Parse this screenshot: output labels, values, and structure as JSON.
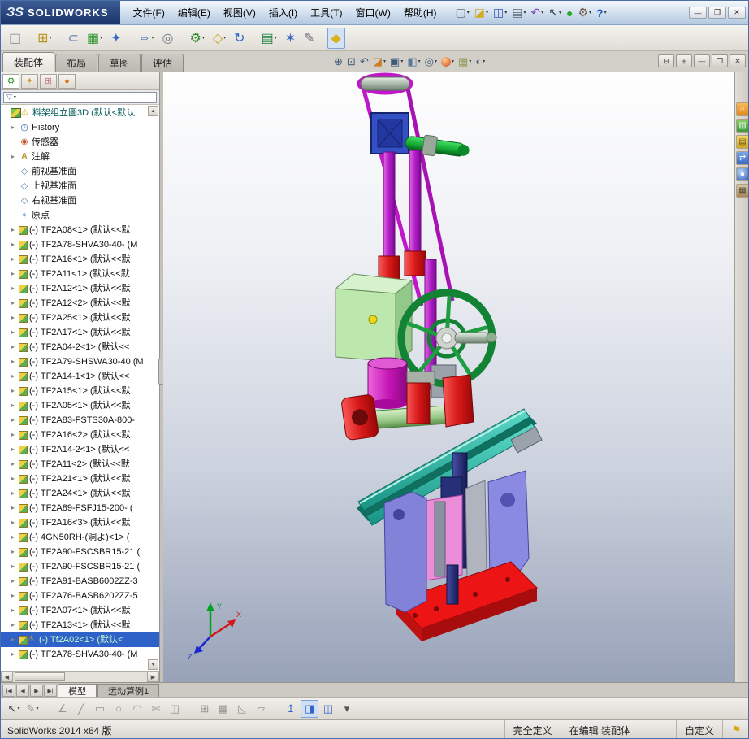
{
  "titlebar": {
    "logo_mark": "ЗS",
    "logo_text": "SOLIDWORKS",
    "menus": [
      "文件(F)",
      "编辑(E)",
      "视图(V)",
      "插入(I)",
      "工具(T)",
      "窗口(W)",
      "帮助(H)"
    ],
    "quick_access": [
      {
        "name": "new-document-button",
        "icon": "new-document-icon",
        "glyph": "▢",
        "style": "color:#607080",
        "dd": "on"
      },
      {
        "name": "open-button",
        "icon": "open-folder-icon",
        "glyph": "◪",
        "style": "color:#d8a820",
        "dd": "on"
      },
      {
        "name": "save-button",
        "icon": "save-floppy-icon",
        "glyph": "◫",
        "style": "color:#3858b8",
        "dd": "on"
      },
      {
        "name": "print-button",
        "icon": "print-icon",
        "glyph": "▤",
        "style": "color:#586878",
        "dd": "on"
      },
      {
        "name": "undo-button",
        "icon": "undo-arrow-icon",
        "glyph": "↶",
        "style": "color:#8048b0",
        "dd": "on"
      },
      {
        "name": "select-button",
        "icon": "select-cursor-icon",
        "glyph": "↖",
        "style": "color:#303840",
        "dd": "on"
      },
      {
        "name": "rebuild-button",
        "icon": "rebuild-traffic-light-icon",
        "glyph": "●",
        "style": "color:#28a828",
        "dd": "off"
      },
      {
        "name": "options-button",
        "icon": "options-gear-icon",
        "glyph": "⚙",
        "style": "color:#705848",
        "dd": "on"
      },
      {
        "name": "help-button",
        "icon": "help-icon",
        "glyph": "?",
        "style": "color:#2858c0;font-weight:bold",
        "dd": "on"
      }
    ],
    "window_controls": [
      {
        "name": "minimize-button",
        "icon": "minimize-icon",
        "glyph": "—"
      },
      {
        "name": "restore-button",
        "icon": "restore-icon",
        "glyph": "❐"
      },
      {
        "name": "close-button",
        "icon": "close-icon",
        "glyph": "✕"
      }
    ]
  },
  "toolbar": {
    "buttons": [
      {
        "name": "pin-panel-button",
        "icon": "pin-panel-icon",
        "glyph": "◫",
        "style": "color:#8890a0",
        "dd": "off",
        "cls": ""
      },
      {
        "name": "insert-components-button",
        "icon": "insert-component-icon",
        "glyph": "⊞",
        "style": "color:#b8941c",
        "dd": "on",
        "cls": "gap"
      },
      {
        "name": "mate-button",
        "icon": "mate-paperclip-icon",
        "glyph": "⊂",
        "style": "color:#6078b8",
        "dd": "off",
        "cls": "gap"
      },
      {
        "name": "linear-component-pattern-button",
        "icon": "component-pattern-icon",
        "glyph": "▦",
        "style": "color:#3a9a3a",
        "dd": "on",
        "cls": ""
      },
      {
        "name": "smart-fasteners-button",
        "icon": "smart-fasteners-icon",
        "glyph": "✦",
        "style": "color:#3868c0",
        "dd": "off",
        "cls": ""
      },
      {
        "name": "move-component-button",
        "icon": "move-component-icon",
        "glyph": "⇔",
        "style": "color:#3060b0",
        "dd": "on",
        "cls": "gap"
      },
      {
        "name": "show-hidden-components-button",
        "icon": "show-hidden-icon",
        "glyph": "◎",
        "style": "color:#707880",
        "dd": "off",
        "cls": ""
      },
      {
        "name": "assembly-features-button",
        "icon": "assembly-features-gear-icon",
        "glyph": "⚙",
        "style": "color:#2a8a2a",
        "dd": "on",
        "cls": "gap"
      },
      {
        "name": "reference-geometry-button",
        "icon": "reference-geometry-icon",
        "glyph": "◇",
        "style": "color:#c8a018",
        "dd": "on",
        "cls": ""
      },
      {
        "name": "new-motion-study-button",
        "icon": "motion-study-icon",
        "glyph": "↻",
        "style": "color:#3068c8",
        "dd": "off",
        "cls": ""
      },
      {
        "name": "bill-of-materials-button",
        "icon": "bill-of-materials-icon",
        "glyph": "▤",
        "style": "color:#2a8a4a",
        "dd": "on",
        "cls": "gap"
      },
      {
        "name": "exploded-view-button",
        "icon": "exploded-view-icon",
        "glyph": "✶",
        "style": "color:#3a62c0",
        "dd": "off",
        "cls": ""
      },
      {
        "name": "explode-line-sketch-button",
        "icon": "explode-line-sketch-icon",
        "glyph": "✎",
        "style": "color:#687078",
        "dd": "off",
        "cls": ""
      },
      {
        "name": "instant3d-button",
        "icon": "instant3d-icon",
        "glyph": "◆",
        "style": "color:#d8b020",
        "dd": "off",
        "cls": "gap pressed"
      }
    ]
  },
  "command_tabs": [
    {
      "name": "assembly-tab",
      "label": "装配体",
      "cls": "active"
    },
    {
      "name": "layout-tab",
      "label": "布局",
      "cls": ""
    },
    {
      "name": "sketch-tab",
      "label": "草图",
      "cls": ""
    },
    {
      "name": "evaluate-tab",
      "label": "评估",
      "cls": ""
    }
  ],
  "docwindow_controls": [
    {
      "name": "doc-pane-left-button",
      "icon": "pane-left-icon",
      "glyph": "⊟"
    },
    {
      "name": "doc-pane-right-button",
      "icon": "pane-right-icon",
      "glyph": "⊞"
    },
    {
      "name": "doc-minimize-button",
      "icon": "doc-minimize-icon",
      "glyph": "—"
    },
    {
      "name": "doc-restore-button",
      "icon": "doc-restore-icon",
      "glyph": "❐"
    },
    {
      "name": "doc-close-button",
      "icon": "doc-close-icon",
      "glyph": "✕"
    }
  ],
  "viewport": {
    "hud": [
      {
        "name": "zoom-fit-button",
        "icon": "zoom-fit-icon",
        "glyph": "⊕",
        "style": "color:#3c5a78",
        "dd": "off"
      },
      {
        "name": "zoom-area-button",
        "icon": "zoom-area-icon",
        "glyph": "⊡",
        "style": "color:#3c5a78",
        "dd": "off"
      },
      {
        "name": "previous-view-button",
        "icon": "previous-view-icon",
        "glyph": "↶",
        "style": "color:#3c5a78",
        "dd": "off"
      },
      {
        "name": "section-view-button",
        "icon": "section-view-icon",
        "glyph": "◪",
        "style": "color:#c88028",
        "dd": "on"
      },
      {
        "name": "view-orientation-button",
        "icon": "view-orientation-cube-icon",
        "glyph": "▣",
        "style": "color:#3c5a78",
        "dd": "on"
      },
      {
        "name": "display-style-button",
        "icon": "display-style-icon",
        "glyph": "◧",
        "style": "color:#5878a0",
        "dd": "on"
      },
      {
        "name": "hide-show-items-button",
        "icon": "hide-show-glasses-icon",
        "glyph": "◎",
        "style": "color:#3c5a78",
        "dd": "on"
      },
      {
        "name": "edit-appearance-button",
        "icon": "appearance-ball-icon",
        "glyph": "●",
        "style": "",
        "cls": "ball",
        "dd": "on"
      },
      {
        "name": "apply-scene-button",
        "icon": "apply-scene-icon",
        "glyph": "▦",
        "style": "color:#8a9a50",
        "dd": "on"
      },
      {
        "name": "view-settings-button",
        "icon": "view-settings-icon",
        "glyph": "◐",
        "style": "color:#3c5a78",
        "dd": "on"
      }
    ],
    "triad": {
      "x": "X",
      "y": "Y",
      "z": "Z"
    }
  },
  "leftpanel": {
    "tabs": [
      {
        "name": "featuremanager-tab",
        "icon": "featuremanager-tree-icon",
        "glyph": "⚙",
        "cls": "pt-fm active"
      },
      {
        "name": "propertymanager-tab",
        "icon": "propertymanager-icon",
        "glyph": "✦",
        "cls": "pt-pm"
      },
      {
        "name": "configurationmanager-tab",
        "icon": "configurationmanager-icon",
        "glyph": "⊞",
        "cls": "pt-cm"
      },
      {
        "name": "displaymanager-tab",
        "icon": "displaymanager-ball-icon",
        "glyph": "●",
        "cls": "pt-dm"
      }
    ],
    "overflow": "»"
  },
  "tree": {
    "items": [
      {
        "rowcls": "root",
        "iconcls": "i-asm",
        "iconname": "assembly-icon",
        "warncls": "on",
        "label": "料架组立圖3D (默认<默认"
      },
      {
        "rowcls": "feat",
        "arrowcls": "on",
        "iconcls": "i-hist",
        "iconname": "history-icon",
        "label": "History"
      },
      {
        "rowcls": "feat",
        "iconcls": "i-sens",
        "iconname": "sensors-icon",
        "label": "传感器"
      },
      {
        "rowcls": "feat",
        "arrowcls": "on",
        "iconcls": "i-anno",
        "iconname": "annotations-icon",
        "label": "注解"
      },
      {
        "rowcls": "feat",
        "iconcls": "i-plane",
        "iconname": "plane-icon",
        "label": "前视基准面"
      },
      {
        "rowcls": "feat",
        "iconcls": "i-plane",
        "iconname": "plane-icon",
        "label": "上视基准面"
      },
      {
        "rowcls": "feat",
        "iconcls": "i-plane",
        "iconname": "plane-icon",
        "label": "右视基准面"
      },
      {
        "rowcls": "feat",
        "iconcls": "i-origin",
        "iconname": "origin-icon",
        "label": "原点"
      },
      {
        "rowcls": "comp",
        "arrowcls": "on",
        "iconcls": "i-comp",
        "iconname": "component-icon",
        "label": "(-) TF2A08<1> (默认<<默"
      },
      {
        "rowcls": "comp",
        "arrowcls": "on",
        "iconcls": "i-comp",
        "iconname": "component-icon",
        "label": "(-) TF2A78-SHVA30-40- (M"
      },
      {
        "rowcls": "comp",
        "arrowcls": "on",
        "iconcls": "i-comp",
        "iconname": "component-icon",
        "label": "(-) TF2A16<1> (默认<<默"
      },
      {
        "rowcls": "comp",
        "arrowcls": "on",
        "iconcls": "i-comp",
        "iconname": "component-icon",
        "label": "(-) TF2A11<1> (默认<<默"
      },
      {
        "rowcls": "comp",
        "arrowcls": "on",
        "iconcls": "i-comp",
        "iconname": "component-icon",
        "label": "(-) TF2A12<1> (默认<<默"
      },
      {
        "rowcls": "comp",
        "arrowcls": "on",
        "iconcls": "i-comp",
        "iconname": "component-icon",
        "label": "(-) TF2A12<2> (默认<<默"
      },
      {
        "rowcls": "comp",
        "arrowcls": "on",
        "iconcls": "i-comp",
        "iconname": "component-icon",
        "label": "(-) TF2A25<1> (默认<<默"
      },
      {
        "rowcls": "comp",
        "arrowcls": "on",
        "iconcls": "i-comp",
        "iconname": "component-icon",
        "label": "(-) TF2A17<1> (默认<<默"
      },
      {
        "rowcls": "comp",
        "arrowcls": "on",
        "iconcls": "i-comp",
        "iconname": "component-icon",
        "label": "(-) TF2A04-2<1> (默认<<"
      },
      {
        "rowcls": "comp",
        "arrowcls": "on",
        "iconcls": "i-comp",
        "iconname": "component-icon",
        "label": "(-) TF2A79-SHSWA30-40 (M"
      },
      {
        "rowcls": "comp",
        "arrowcls": "on",
        "iconcls": "i-comp",
        "iconname": "component-icon",
        "label": "(-) TF2A14-1<1> (默认<<"
      },
      {
        "rowcls": "comp",
        "arrowcls": "on",
        "iconcls": "i-comp",
        "iconname": "component-icon",
        "label": "(-) TF2A15<1> (默认<<默"
      },
      {
        "rowcls": "comp",
        "arrowcls": "on",
        "iconcls": "i-comp",
        "iconname": "component-icon",
        "label": "(-) TF2A05<1> (默认<<默"
      },
      {
        "rowcls": "comp",
        "arrowcls": "on",
        "iconcls": "i-comp",
        "iconname": "component-icon",
        "label": "(-) TF2A83-FSTS30A-800-"
      },
      {
        "rowcls": "comp",
        "arrowcls": "on",
        "iconcls": "i-comp",
        "iconname": "component-icon",
        "label": "(-) TF2A16<2> (默认<<默"
      },
      {
        "rowcls": "comp",
        "arrowcls": "on",
        "iconcls": "i-comp",
        "iconname": "component-icon",
        "label": "(-) TF2A14-2<1> (默认<<"
      },
      {
        "rowcls": "comp",
        "arrowcls": "on",
        "iconcls": "i-comp",
        "iconname": "component-icon",
        "label": "(-) TF2A11<2> (默认<<默"
      },
      {
        "rowcls": "comp",
        "arrowcls": "on",
        "iconcls": "i-comp",
        "iconname": "component-icon",
        "label": "(-) TF2A21<1> (默认<<默"
      },
      {
        "rowcls": "comp",
        "arrowcls": "on",
        "iconcls": "i-comp",
        "iconname": "component-icon",
        "label": "(-) TF2A24<1> (默认<<默"
      },
      {
        "rowcls": "comp",
        "arrowcls": "on",
        "iconcls": "i-comp",
        "iconname": "component-icon",
        "label": "(-) TF2A89-FSFJ15-200- ("
      },
      {
        "rowcls": "comp",
        "arrowcls": "on",
        "iconcls": "i-comp",
        "iconname": "component-icon",
        "label": "(-) TF2A16<3> (默认<<默"
      },
      {
        "rowcls": "comp",
        "arrowcls": "on",
        "iconcls": "i-comp",
        "iconname": "component-icon",
        "label": "(-) 4GN50RH-(洞よ)<1> ("
      },
      {
        "rowcls": "comp",
        "arrowcls": "on",
        "iconcls": "i-comp",
        "iconname": "component-icon",
        "label": "(-) TF2A90-FSCSBR15-21 ("
      },
      {
        "rowcls": "comp",
        "arrowcls": "on",
        "iconcls": "i-comp",
        "iconname": "component-icon",
        "label": "(-) TF2A90-FSCSBR15-21 ("
      },
      {
        "rowcls": "comp",
        "arrowcls": "on",
        "iconcls": "i-comp",
        "iconname": "component-icon",
        "label": "(-) TF2A91-BASB6002ZZ-3"
      },
      {
        "rowcls": "comp",
        "arrowcls": "on",
        "iconcls": "i-comp",
        "iconname": "component-icon",
        "label": "(-) TF2A76-BASB6202ZZ-5"
      },
      {
        "rowcls": "comp",
        "arrowcls": "on",
        "iconcls": "i-comp",
        "iconname": "component-icon",
        "label": "(-) TF2A07<1> (默认<<默"
      },
      {
        "rowcls": "comp",
        "arrowcls": "on",
        "iconcls": "i-comp",
        "iconname": "component-icon",
        "label": "(-) TF2A13<1> (默认<<默"
      },
      {
        "rowcls": "comp sel",
        "arrowcls": "on",
        "iconcls": "i-comp",
        "iconname": "component-icon",
        "warncls": "on",
        "label": "(-) Tf2A02<1> (默认<"
      },
      {
        "rowcls": "comp",
        "arrowcls": "on",
        "iconcls": "i-comp",
        "iconname": "component-icon",
        "label": "(-) TF2A78-SHVA30-40- (M"
      }
    ]
  },
  "taskpane": {
    "tabs": [
      {
        "name": "solidworks-resources-tab",
        "icon": "home-icon",
        "glyph": "⌂",
        "cls": "tp-home"
      },
      {
        "name": "design-library-tab",
        "icon": "design-library-icon",
        "glyph": "▥",
        "cls": "tp-lib"
      },
      {
        "name": "file-explorer-tab",
        "icon": "folder-icon",
        "glyph": "▤",
        "cls": "tp-files"
      },
      {
        "name": "view-palette-tab",
        "icon": "view-palette-icon",
        "glyph": "⇄",
        "cls": "tp-palette"
      },
      {
        "name": "appearances-scenes-tab",
        "icon": "appearance-sphere-icon",
        "glyph": "●",
        "cls": "tp-appear"
      },
      {
        "name": "custom-properties-tab",
        "icon": "custom-properties-icon",
        "glyph": "▦",
        "cls": "tp-props"
      }
    ]
  },
  "bottom_tabs": {
    "nav": [
      {
        "name": "first-tab-button",
        "icon": "first-tab-icon",
        "glyph": "|◀"
      },
      {
        "name": "prev-tab-button",
        "icon": "prev-tab-icon",
        "glyph": "◀"
      },
      {
        "name": "next-tab-button",
        "icon": "next-tab-icon",
        "glyph": "▶"
      },
      {
        "name": "last-tab-button",
        "icon": "last-tab-icon",
        "glyph": "▶|"
      }
    ],
    "tabs": [
      {
        "name": "model-tab",
        "label": "模型",
        "cls": "active"
      },
      {
        "name": "motion-study-tab",
        "label": "运动算例1",
        "cls": ""
      }
    ]
  },
  "sketchbar": {
    "buttons": [
      {
        "name": "select-button",
        "icon": "select-cursor-icon",
        "glyph": "↖",
        "style": "color:#404040",
        "dd": "on",
        "cls": ""
      },
      {
        "name": "sketch-button",
        "icon": "sketch-pencil-icon",
        "glyph": "✎",
        "style": "color:#9a958c",
        "dd": "on",
        "cls": ""
      },
      {
        "name": "smart-dimension-button",
        "icon": "smart-dimension-icon",
        "glyph": "∠",
        "style": "color:#9a958c",
        "dd": "off",
        "cls": "gap"
      },
      {
        "name": "line-button",
        "icon": "line-icon",
        "glyph": "╱",
        "style": "color:#9a958c",
        "dd": "off",
        "cls": ""
      },
      {
        "name": "rectangle-button",
        "icon": "rectangle-icon",
        "glyph": "▭",
        "style": "color:#9a958c",
        "dd": "off",
        "cls": ""
      },
      {
        "name": "circle-button",
        "icon": "circle-icon",
        "glyph": "○",
        "style": "color:#9a958c",
        "dd": "off",
        "cls": ""
      },
      {
        "name": "arc-button",
        "icon": "arc-icon",
        "glyph": "◠",
        "style": "color:#9a958c",
        "dd": "off",
        "cls": ""
      },
      {
        "name": "trim-button",
        "icon": "trim-scissors-icon",
        "glyph": "✄",
        "style": "color:#9a958c",
        "dd": "off",
        "cls": ""
      },
      {
        "name": "mirror-button",
        "icon": "mirror-icon",
        "glyph": "◫",
        "style": "color:#9a958c",
        "dd": "off",
        "cls": ""
      },
      {
        "name": "display-grid-button",
        "icon": "grid-icon",
        "glyph": "⊞",
        "style": "color:#9a958c",
        "dd": "off",
        "cls": "gap"
      },
      {
        "name": "snap-button",
        "icon": "snap-grid-icon",
        "glyph": "▦",
        "style": "color:#9a958c",
        "dd": "off",
        "cls": ""
      },
      {
        "name": "angle-snap-button",
        "icon": "angle-icon",
        "glyph": "◺",
        "style": "color:#9a958c",
        "dd": "off",
        "cls": ""
      },
      {
        "name": "plane-display-button",
        "icon": "plane-display-icon",
        "glyph": "▱",
        "style": "color:#9a958c",
        "dd": "off",
        "cls": ""
      },
      {
        "name": "up-axis-button",
        "icon": "up-arrow-icon",
        "glyph": "↥",
        "style": "color:#3864c8",
        "dd": "off",
        "cls": "gap"
      },
      {
        "name": "shaded-view-button",
        "icon": "shaded-cube-icon",
        "glyph": "◨",
        "style": "color:#3864c8",
        "dd": "off",
        "cls": "pressed"
      },
      {
        "name": "save-view-button",
        "icon": "save-floppy-icon",
        "glyph": "◫",
        "style": "color:#3864c8",
        "dd": "off",
        "cls": ""
      },
      {
        "name": "more-options-button",
        "icon": "more-options-icon",
        "glyph": "▾",
        "style": "color:#555",
        "dd": "off",
        "cls": ""
      }
    ]
  },
  "status": {
    "app": "SolidWorks 2014 x64 版",
    "defined": "完全定义",
    "editing": "在编辑 装配体",
    "custom": "自定义"
  }
}
